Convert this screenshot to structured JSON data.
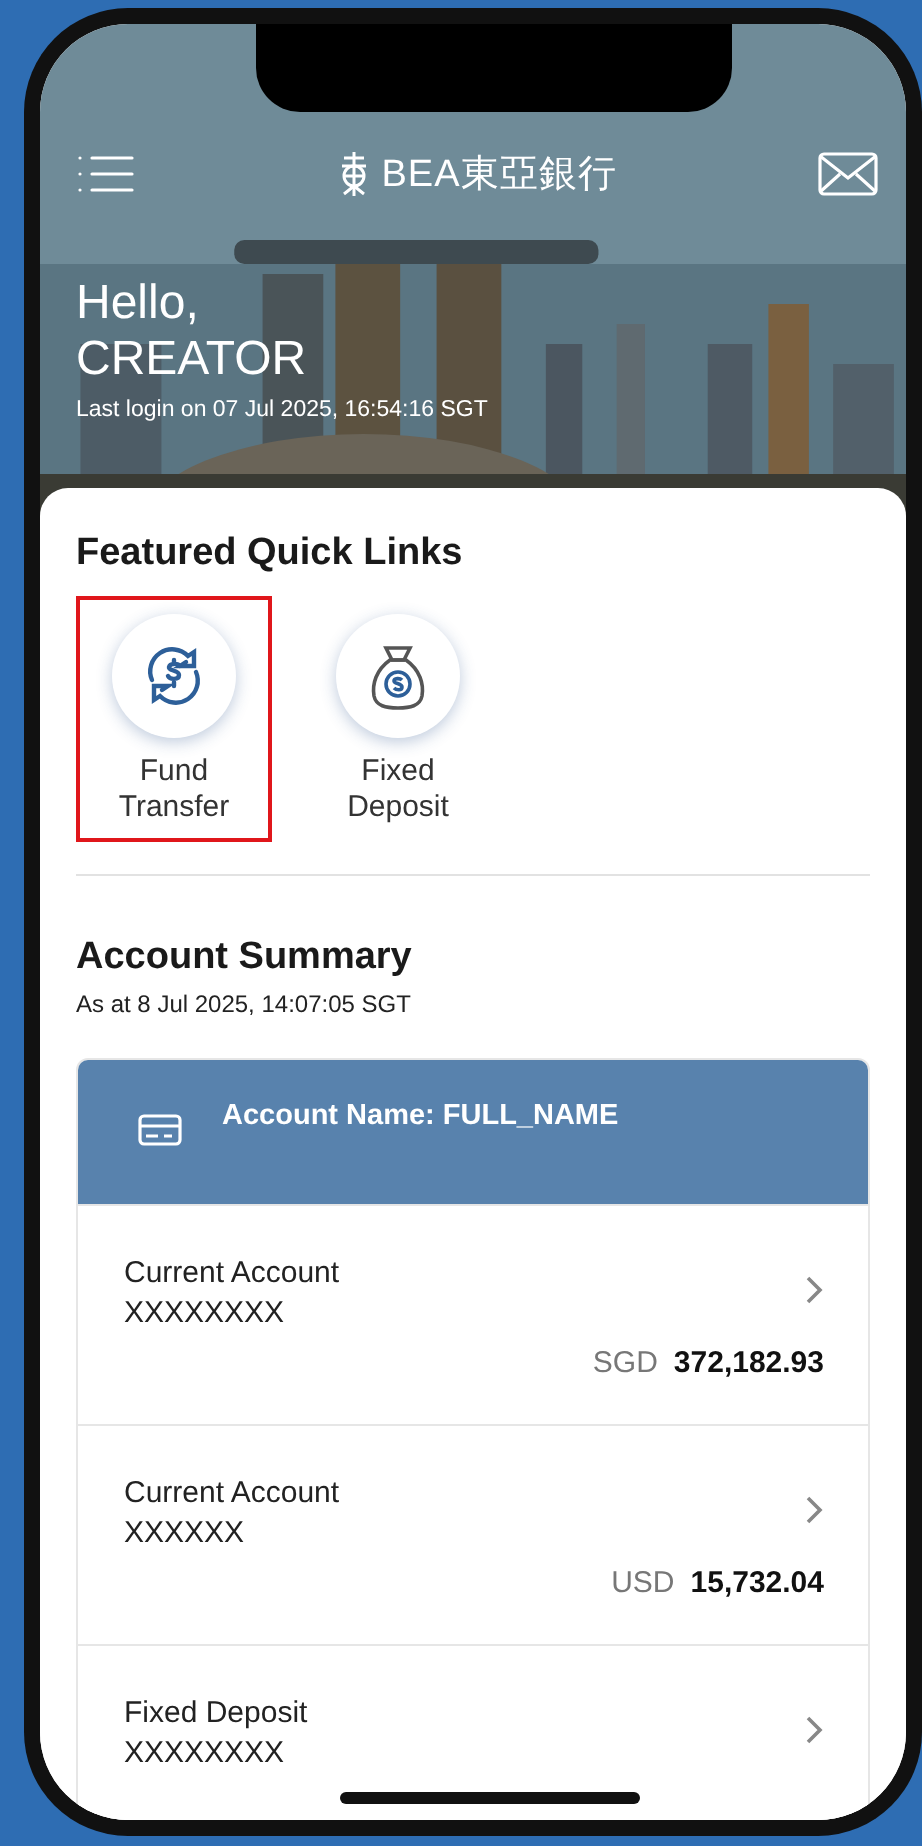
{
  "header": {
    "logo_text": "BEA東亞銀行",
    "greeting": "Hello,",
    "user_name": "CREATOR",
    "last_login": "Last login on 07 Jul 2025, 16:54:16 SGT"
  },
  "quick_links": {
    "title": "Featured Quick Links",
    "items": [
      {
        "label": "Fund Transfer",
        "kind": "transfer",
        "highlighted": true
      },
      {
        "label": "Fixed Deposit",
        "kind": "deposit",
        "highlighted": false
      }
    ]
  },
  "account_summary": {
    "title": "Account Summary",
    "as_at": "As at 8 Jul 2025, 14:07:05 SGT",
    "account_name": "Account Name: FULL_NAME",
    "accounts": [
      {
        "type": "Current Account",
        "number": "XXXXXXXX",
        "currency": "SGD",
        "balance": "372,182.93"
      },
      {
        "type": "Current Account",
        "number": "XXXXXX",
        "currency": "USD",
        "balance": "15,732.04"
      },
      {
        "type": "Fixed Deposit",
        "number": "XXXXXXXX"
      }
    ]
  }
}
